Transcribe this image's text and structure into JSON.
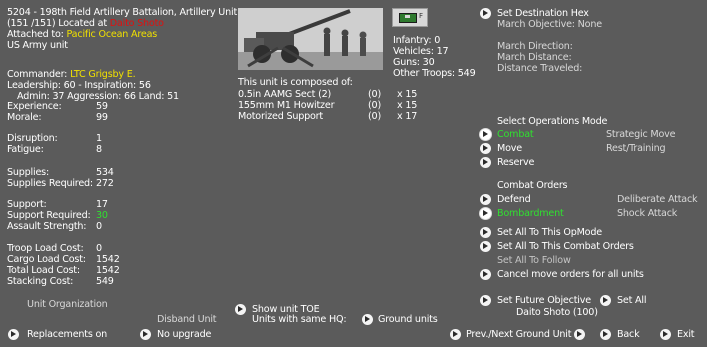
{
  "unit": {
    "title": "5204 - 198th Field Artillery Battalion, Artillery Unit",
    "strength_loc": "(151 /151) Located at",
    "location": "Daito Shoto",
    "attached_label": "Attached to:",
    "attached_value": "Pacific Ocean Areas",
    "army": "US Army unit"
  },
  "commander": {
    "label": "Commander:",
    "name": "LTC Grigsby E.",
    "leadership": "Leadership: 60 - Inspiration: 56",
    "admin": "Admin: 37  Aggression: 66 Land: 51"
  },
  "stats": {
    "experience_label": "Experience:",
    "experience": "59",
    "morale_label": "Morale:",
    "morale": "99",
    "disruption_label": "Disruption:",
    "disruption": "1",
    "fatigue_label": "Fatigue:",
    "fatigue": "8",
    "supplies_label": "Supplies:",
    "supplies": "534",
    "supplies_req_label": "Supplies Required:",
    "supplies_req": "272",
    "support_label": "Support:",
    "support": "17",
    "support_req_label": "Support Required:",
    "support_req": "30",
    "assault_label": "Assault Strength:",
    "assault": "0",
    "troop_load_label": "Troop Load Cost:",
    "troop_load": "0",
    "cargo_load_label": "Cargo Load Cost:",
    "cargo_load": "1542",
    "total_load_label": "Total Load Cost:",
    "total_load": "1542",
    "stacking_label": "Stacking Cost:",
    "stacking": "549"
  },
  "counts": {
    "infantry": "Infantry: 0",
    "vehicles": "Vehicles: 17",
    "guns": "Guns: 30",
    "other": "Other Troops: 549"
  },
  "composition": {
    "header": "This unit is composed of:",
    "rows": [
      {
        "name": "0.5in AAMG Sect (2)",
        "paren": "(0)",
        "count": "x 15"
      },
      {
        "name": "155mm M1 Howitzer",
        "paren": "(0)",
        "count": "x 15"
      },
      {
        "name": "Motorized Support",
        "paren": "(0)",
        "count": "x 17"
      }
    ]
  },
  "destination": {
    "set_label": "Set Destination Hex",
    "march_objective": "March Objective: None",
    "march_direction": "March Direction:",
    "march_distance": "March Distance:",
    "distance_traveled": "Distance Traveled:"
  },
  "ops": {
    "header": "Select Operations Mode",
    "combat": "Combat",
    "strategic": "Strategic Move",
    "move": "Move",
    "rest": "Rest/Training",
    "reserve": "Reserve"
  },
  "orders": {
    "header": "Combat Orders",
    "defend": "Defend",
    "deliberate": "Deliberate Attack",
    "bombardment": "Bombardment",
    "shock": "Shock Attack"
  },
  "actions": {
    "all_opmode": "Set All To This OpMode",
    "all_combat": "Set All To This Combat Orders",
    "all_follow": "Set All To Follow",
    "cancel_move": "Cancel move orders for all units",
    "future_objective": "Set Future Objective",
    "set_all": "Set All",
    "objective_value": "Daito Shoto (100)"
  },
  "bottom": {
    "unit_org": "Unit Organization",
    "disband": "Disband Unit",
    "show_toe": "Show unit TOE",
    "same_hq": "Units with same HQ:",
    "ground_units": "Ground units",
    "replacements": "Replacements on",
    "no_upgrade": "No upgrade",
    "prev_next": "Prev./Next Ground Unit",
    "back": "Back",
    "exit": "Exit"
  },
  "colors": {
    "background": "#5b5b5b",
    "highlight_green": "#30e030",
    "location_red": "#e01010",
    "attached_yellow": "#f0e000"
  }
}
